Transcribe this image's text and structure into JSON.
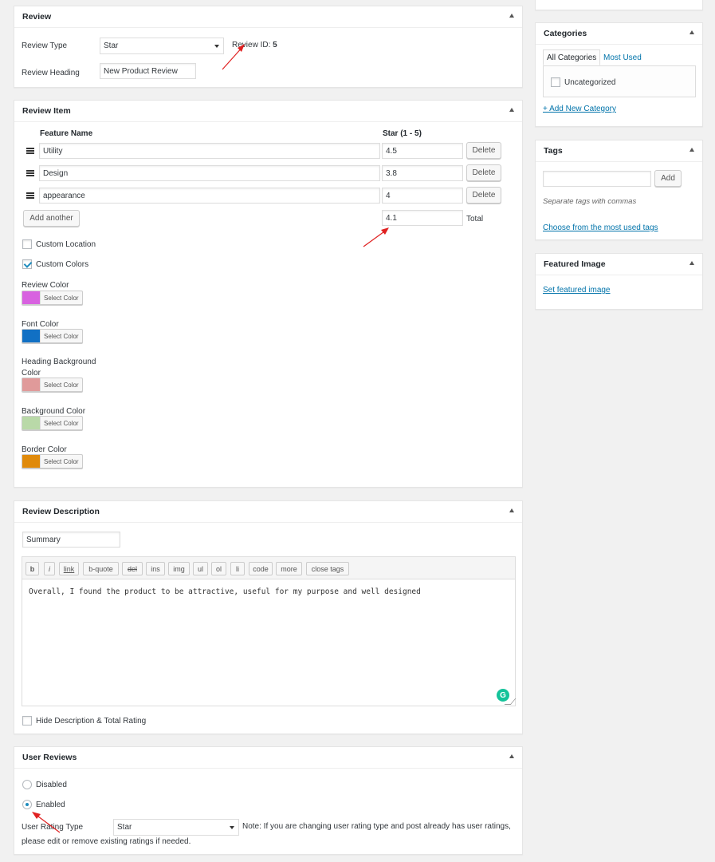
{
  "review": {
    "title": "Review",
    "type_label": "Review Type",
    "type_value": "Star",
    "id_label": "Review ID:",
    "id_value": "5",
    "heading_label": "Review Heading",
    "heading_value": "New Product Review"
  },
  "review_item": {
    "title": "Review Item",
    "col_feature": "Feature Name",
    "col_star": "Star (1 - 5)",
    "rows": [
      {
        "name": "Utility",
        "value": "4.5",
        "delete": "Delete"
      },
      {
        "name": "Design",
        "value": "3.8",
        "delete": "Delete"
      },
      {
        "name": "appearance",
        "value": "4",
        "delete": "Delete"
      }
    ],
    "add_another": "Add another",
    "total_value": "4.1",
    "total_label": "Total",
    "custom_location": "Custom Location",
    "custom_colors": "Custom Colors",
    "select_color": "Select Color",
    "colors": [
      {
        "label": "Review Color",
        "hex": "#d862e0"
      },
      {
        "label": "Font Color",
        "hex": "#1170c4"
      },
      {
        "label": "Heading Background Color",
        "hex": "#e09a9a"
      },
      {
        "label": "Background Color",
        "hex": "#b9d9a8"
      },
      {
        "label": "Border Color",
        "hex": "#e08a0b"
      }
    ]
  },
  "description": {
    "title": "Review Description",
    "summary_value": "Summary",
    "toolbar": [
      "b",
      "i",
      "link",
      "b-quote",
      "del",
      "ins",
      "img",
      "ul",
      "ol",
      "li",
      "code",
      "more",
      "close tags"
    ],
    "body": "Overall, I found the product to be attractive, useful for my purpose and well designed",
    "hide_label": "Hide Description & Total Rating"
  },
  "user_reviews": {
    "title": "User Reviews",
    "disabled": "Disabled",
    "enabled": "Enabled",
    "rating_type_label": "User Rating Type",
    "rating_type_value": "Star",
    "note_line1": "Note: If you are changing user rating type and post already has user ratings,",
    "note_line2": "please edit or remove existing ratings if needed."
  },
  "categories": {
    "title": "Categories",
    "tab_all": "All Categories",
    "tab_most_used": "Most Used",
    "item": "Uncategorized",
    "add_new": "+ Add New Category"
  },
  "tags": {
    "title": "Tags",
    "add_button": "Add",
    "hint": "Separate tags with commas",
    "choose_link": "Choose from the most used tags"
  },
  "featured_image": {
    "title": "Featured Image",
    "set_link": "Set featured image"
  },
  "accent": {
    "link": "#0073aa",
    "arrow": "#e02020",
    "grammarly": "#15c39a"
  }
}
